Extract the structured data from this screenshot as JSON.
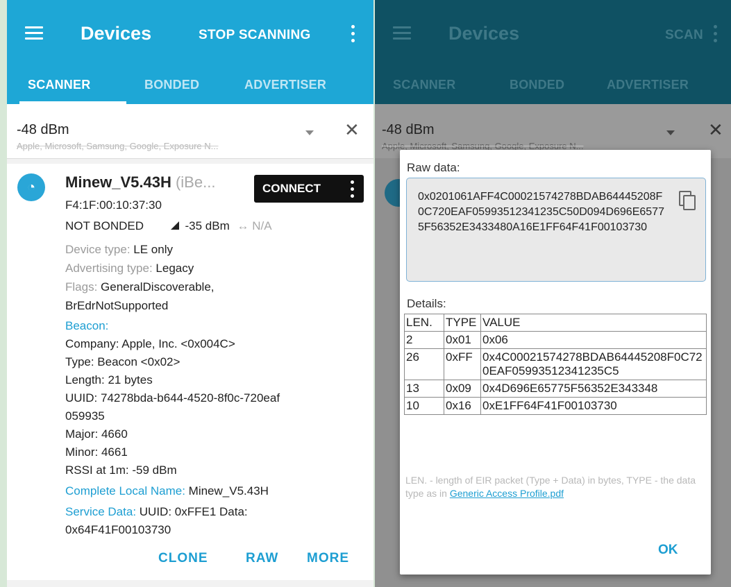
{
  "left": {
    "appbar": {
      "title": "Devices",
      "action": "STOP SCANNING"
    },
    "tabs": [
      {
        "label": "SCANNER"
      },
      {
        "label": "BONDED"
      },
      {
        "label": "ADVERTISER"
      }
    ],
    "filter": {
      "rssi": "-48 dBm",
      "subtitle": "Apple, Microsoft, Samsung, Google, Exposure N..."
    },
    "device": {
      "icon": "wifi-signal-icon",
      "name": "Minew_V5.43H",
      "type_hint": "(iBe...",
      "address": "F4:1F:00:10:37:30",
      "bond_state": "NOT BONDED",
      "rssi": "-35 dBm",
      "interval": "↔ N/A",
      "connect_label": "CONNECT",
      "device_type_key": "Device type:",
      "device_type_value": "LE only",
      "adv_type_key": "Advertising type:",
      "adv_type_value": "Legacy",
      "flags_key": "Flags:",
      "flags_value": "GeneralDiscoverable,",
      "flags_value2": "BrEdrNotSupported",
      "beacon_header": "Beacon:",
      "beacon_lines": [
        "Company: Apple, Inc. <0x004C>",
        "Type: Beacon <0x02>",
        "Length: 21 bytes",
        "UUID: 74278bda-b644-4520-8f0c-720eaf",
        "059935",
        "Major: 4660",
        "Minor: 4661",
        "RSSI at 1m: -59 dBm"
      ],
      "local_name_key": "Complete Local Name:",
      "local_name_value": "Minew_V5.43H",
      "service_data_key": "Service Data:",
      "service_data_value": "UUID: 0xFFE1 Data:",
      "service_data_value2": "0x64F41F00103730"
    },
    "actions": {
      "clone": "CLONE",
      "raw": "RAW",
      "more": "MORE"
    }
  },
  "right": {
    "appbar": {
      "title": "Devices",
      "action": "SCAN"
    },
    "tabs": [
      {
        "label": "SCANNER"
      },
      {
        "label": "BONDED"
      },
      {
        "label": "ADVERTISER"
      }
    ],
    "filter": {
      "rssi": "-48 dBm",
      "subtitle": "Apple, Microsoft, Samsung, Google, Exposure N..."
    }
  },
  "dialog": {
    "raw_label": "Raw data:",
    "raw_value": "0x0201061AFF4C00021574278BDAB64445208F0C720EAF05993512341235C50D094D696E65775F56352E3433480A16E1FF64F41F00103730",
    "details_label": "Details:",
    "columns": [
      "LEN.",
      "TYPE",
      "VALUE"
    ],
    "rows": [
      [
        "2",
        "0x01",
        "0x06"
      ],
      [
        "26",
        "0xFF",
        "0x4C00021574278BDAB64445208F0C720EAF05993512341235C5"
      ],
      [
        "13",
        "0x09",
        "0x4D696E65775F56352E343348"
      ],
      [
        "10",
        "0x16",
        "0xE1FF64F41F00103730"
      ]
    ],
    "legend_text": "LEN. - length of EIR packet (Type + Data) in bytes, TYPE - the data type as in ",
    "legend_link": "Generic Access Profile.pdf",
    "ok_label": "OK"
  }
}
